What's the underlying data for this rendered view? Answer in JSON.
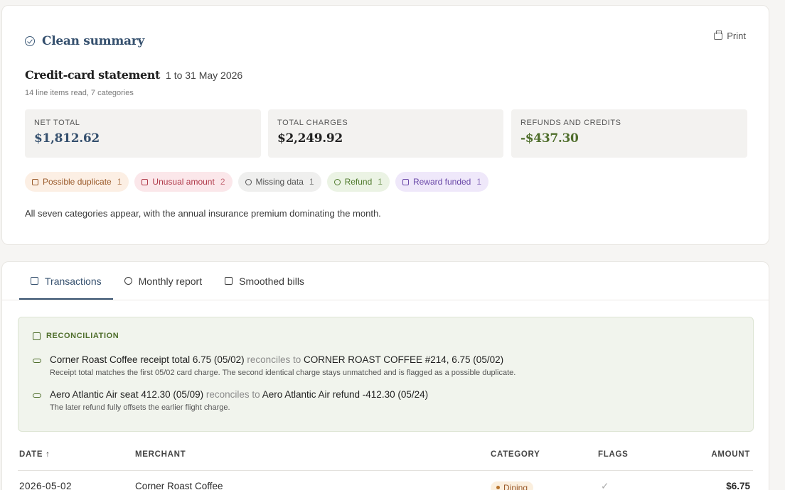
{
  "summary": {
    "title": "Clean summary",
    "print_label": "Print",
    "statement_title": "Credit-card statement",
    "statement_range": "1 to 31 May 2026",
    "statement_sub": "14 line items read, 7 categories",
    "stats": {
      "net_label": "NET TOTAL",
      "net_value": "$1,812.62",
      "charges_label": "TOTAL CHARGES",
      "charges_value": "$2,249.92",
      "refunds_label": "REFUNDS AND CREDITS",
      "refunds_value": "-$437.30"
    },
    "flags": [
      {
        "label": "Possible duplicate",
        "count": "1"
      },
      {
        "label": "Unusual amount",
        "count": "2"
      },
      {
        "label": "Missing data",
        "count": "1"
      },
      {
        "label": "Refund",
        "count": "1"
      },
      {
        "label": "Reward funded",
        "count": "1"
      }
    ],
    "note": "All seven categories appear, with the annual insurance premium dominating the month."
  },
  "tabs": [
    {
      "label": "Transactions"
    },
    {
      "label": "Monthly report"
    },
    {
      "label": "Smoothed bills"
    }
  ],
  "reconciliation": {
    "heading": "RECONCILIATION",
    "items": [
      {
        "left": "Corner Roast Coffee receipt total 6.75 (05/02)",
        "mid": "reconciles to",
        "right": "CORNER ROAST COFFEE #214, 6.75 (05/02)",
        "sub": "Receipt total matches the first 05/02 card charge. The second identical charge stays unmatched and is flagged as a possible duplicate."
      },
      {
        "left": "Aero Atlantic Air seat 412.30 (05/09)",
        "mid": "reconciles to",
        "right": "Aero Atlantic Air refund -412.30 (05/24)",
        "sub": "The later refund fully offsets the earlier flight charge."
      }
    ]
  },
  "table": {
    "headers": {
      "date": "DATE ↑",
      "merchant": "MERCHANT",
      "category": "CATEGORY",
      "flags": "FLAGS",
      "amount": "AMOUNT"
    },
    "rows": [
      {
        "date": "2026-05-02",
        "merchant": "Corner Roast Coffee",
        "category": "Dining",
        "flags": "✓",
        "amount": "$6.75"
      }
    ]
  }
}
